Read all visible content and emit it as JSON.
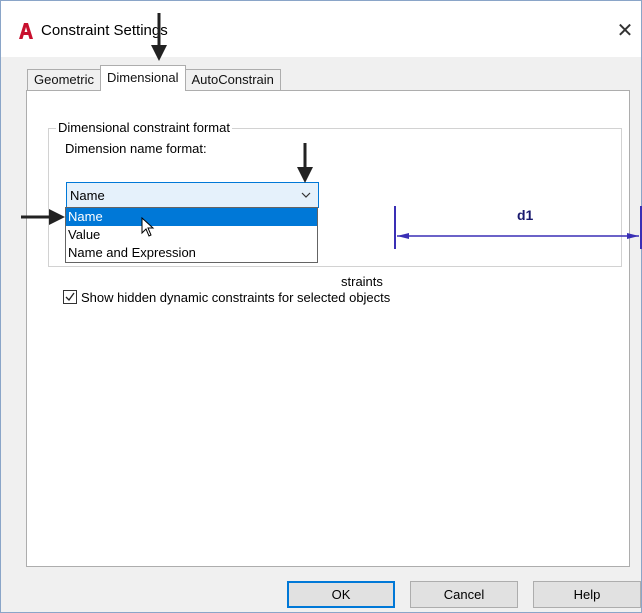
{
  "window": {
    "title": "Constraint Settings",
    "app_icon": "autocad-a-icon",
    "close_glyph": "✕"
  },
  "tabs": [
    {
      "label": "Geometric",
      "active": false
    },
    {
      "label": "Dimensional",
      "active": true
    },
    {
      "label": "AutoConstrain",
      "active": false
    }
  ],
  "dimensional": {
    "group_title": "Dimensional constraint format",
    "name_format_label": "Dimension name format:",
    "name_format_value": "Name",
    "options": [
      "Name",
      "Value",
      "Name and Expression"
    ],
    "highlighted_option": "Name",
    "partially_hidden_text": "straints",
    "preview_label": "d1",
    "show_hidden_checked": true,
    "show_hidden_label": "Show hidden dynamic constraints for selected objects"
  },
  "buttons": {
    "ok": "OK",
    "cancel": "Cancel",
    "help": "Help"
  },
  "colors": {
    "accent": "#0078d7",
    "dimension_line": "#3a2fb5",
    "brand_red": "#c8102e"
  }
}
